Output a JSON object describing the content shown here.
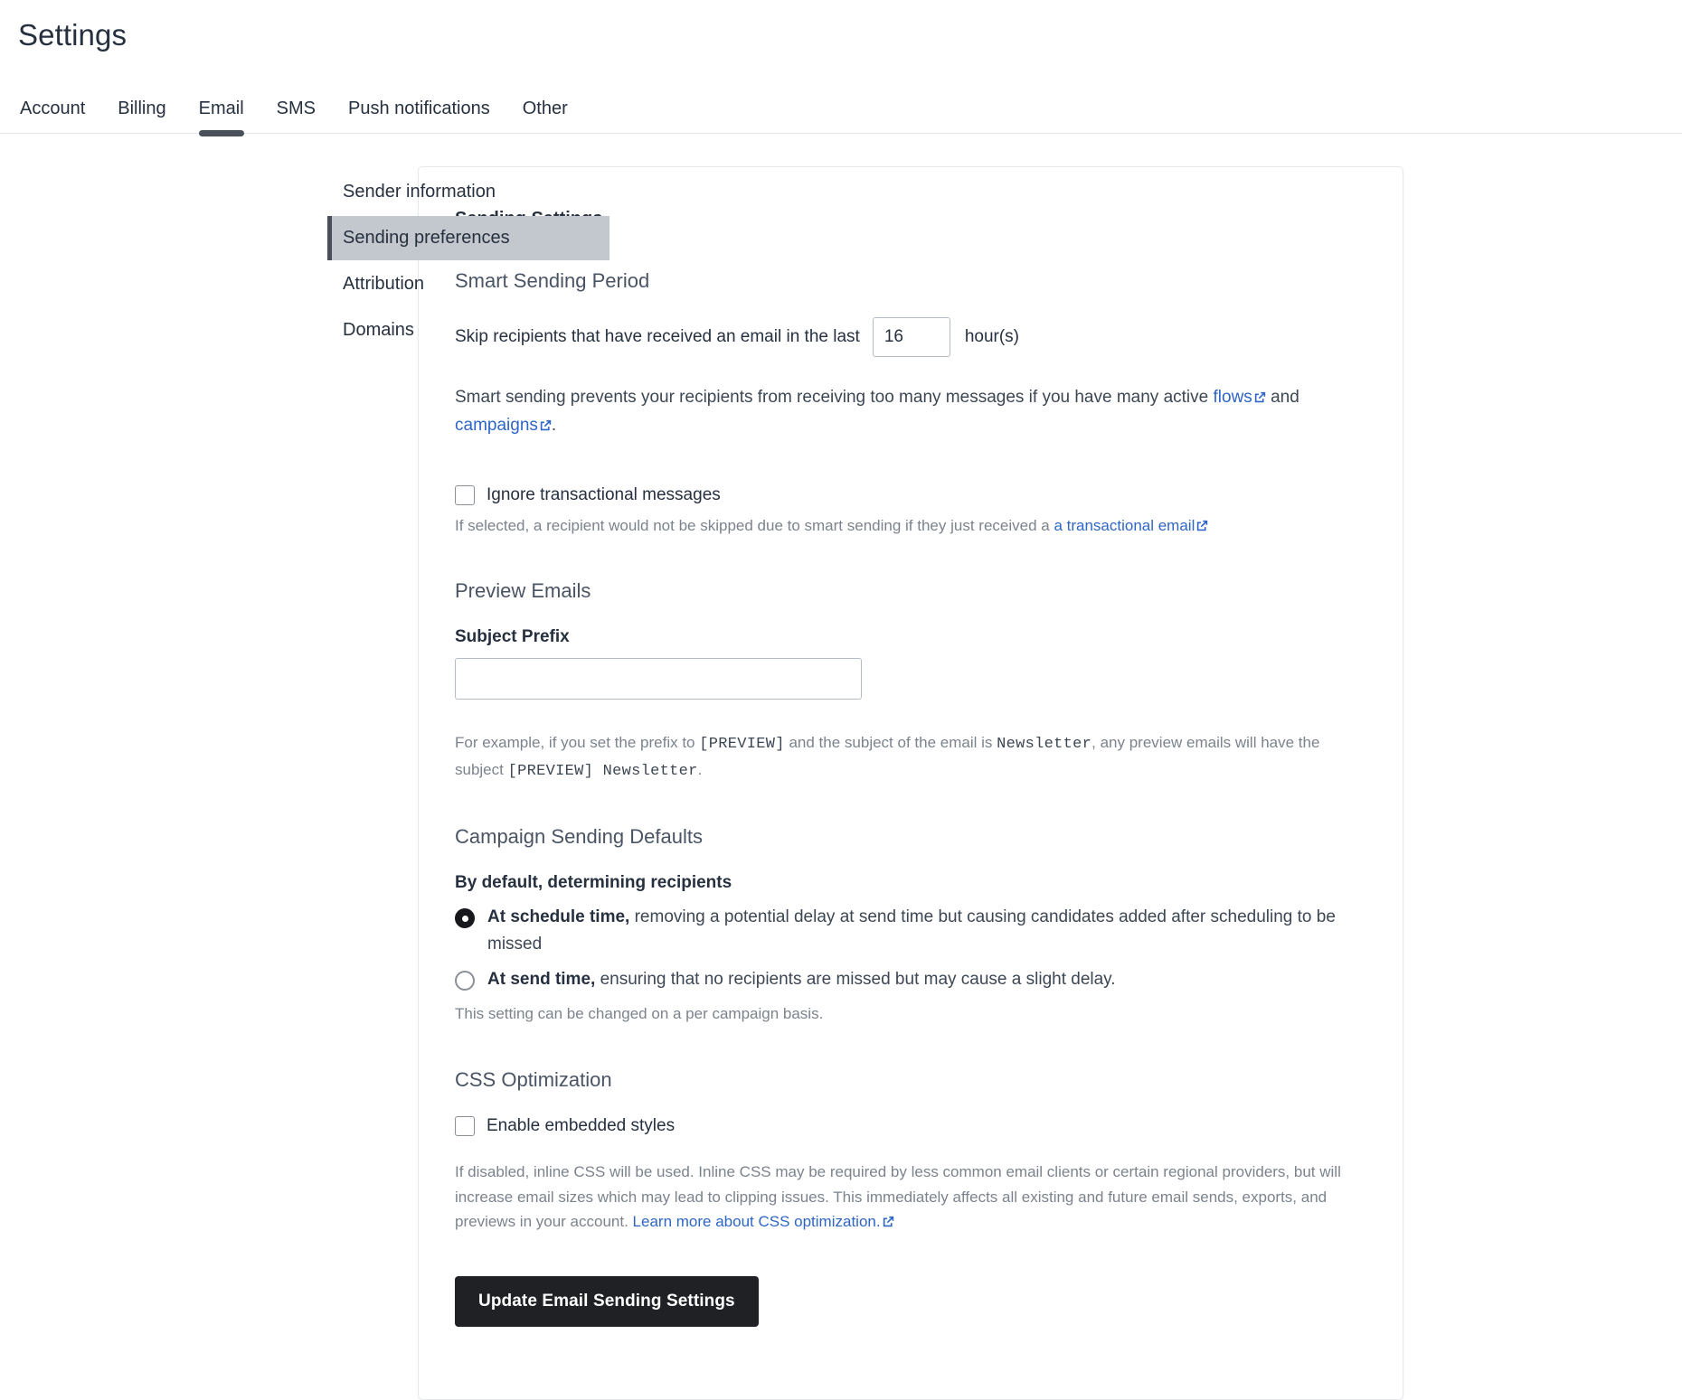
{
  "header": {
    "title": "Settings",
    "tabs": [
      {
        "label": "Account",
        "active": false
      },
      {
        "label": "Billing",
        "active": false
      },
      {
        "label": "Email",
        "active": true
      },
      {
        "label": "SMS",
        "active": false
      },
      {
        "label": "Push notifications",
        "active": false
      },
      {
        "label": "Other",
        "active": false
      }
    ]
  },
  "sidebar": {
    "items": [
      {
        "label": "Sender information",
        "active": false
      },
      {
        "label": "Sending preferences",
        "active": true
      },
      {
        "label": "Attribution",
        "active": false
      },
      {
        "label": "Domains",
        "active": false
      }
    ]
  },
  "card": {
    "title": "Sending Settings",
    "smart_sending": {
      "section_title": "Smart Sending Period",
      "skip_label": "Skip recipients that have received an email in the last",
      "hours_value": "16",
      "hours_placeholder": "",
      "hours_suffix": "hour(s)",
      "description_part1": "Smart sending prevents your recipients from receiving too many messages if you have many active ",
      "flows_link": "flows",
      "description_part2": " and ",
      "campaigns_link": "campaigns",
      "description_part3": ".",
      "ignore_checkbox_label": "Ignore transactional messages",
      "ignore_checked": false,
      "ignore_help_part1": "If selected, a recipient would not be skipped due to smart sending if they just received a ",
      "transactional_link": "a transactional email"
    },
    "preview_emails": {
      "section_title": "Preview Emails",
      "subject_prefix_label": "Subject Prefix",
      "subject_prefix_value": "",
      "subject_prefix_placeholder": "",
      "example_part1": "For example, if you set the prefix to ",
      "example_code1": "[PREVIEW]",
      "example_part2": " and the subject of the email is ",
      "example_code2": "Newsletter",
      "example_part3": ", any preview emails will have the subject ",
      "example_code3": "[PREVIEW] Newsletter",
      "example_part4": "."
    },
    "campaign_defaults": {
      "section_title": "Campaign Sending Defaults",
      "group_label": "By default, determining recipients",
      "options": [
        {
          "strong": "At schedule time,",
          "rest": " removing a potential delay at send time but causing candidates added after scheduling to be missed",
          "selected": true
        },
        {
          "strong": "At send time,",
          "rest": " ensuring that no recipients are missed but may cause a slight delay.",
          "selected": false
        }
      ],
      "footnote": "This setting can be changed on a per campaign basis."
    },
    "css_optimization": {
      "section_title": "CSS Optimization",
      "checkbox_label": "Enable embedded styles",
      "checked": false,
      "help_part1": "If disabled, inline CSS will be used. Inline CSS may be required by less common email clients or certain regional providers, but will increase email sizes which may lead to clipping issues. This immediately affects all existing and future email sends, exports, and previews in your account. ",
      "learn_more_link": "Learn more about CSS optimization."
    },
    "submit_label": "Update Email Sending Settings"
  },
  "colors": {
    "accent_link": "#2f66c4",
    "button_bg": "#1f2124",
    "sidebar_active_bg": "#c2c8ce",
    "sidebar_active_bar": "#4a5059"
  }
}
